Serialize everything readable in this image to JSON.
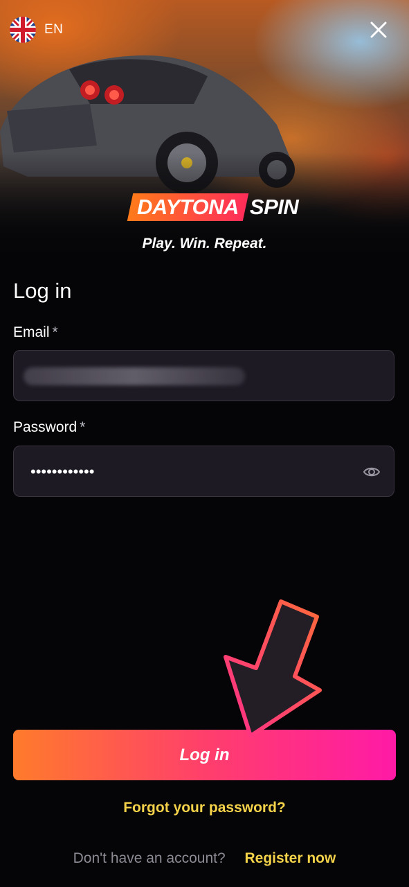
{
  "header": {
    "language_code": "EN",
    "logo_part1": "DAYTONA",
    "logo_part2": "SPIN",
    "tagline": "Play. Win. Repeat."
  },
  "form": {
    "title": "Log in",
    "email_label": "Email",
    "email_required_mark": "*",
    "password_label": "Password",
    "password_required_mark": "*",
    "password_value": "••••••••••••",
    "submit_label": "Log in",
    "forgot_password": "Forgot your password?"
  },
  "footer": {
    "question": "Don't have an account?",
    "register_link": "Register now"
  },
  "colors": {
    "accent_yellow": "#f4d24a",
    "button_gradient_start": "#ff7b2b",
    "button_gradient_end": "#ff1aa6",
    "field_background": "#1e1a24",
    "page_background": "#050507"
  },
  "icons": [
    "uk-flag-icon",
    "close-icon",
    "eye-icon",
    "pointer-arrow-icon"
  ]
}
